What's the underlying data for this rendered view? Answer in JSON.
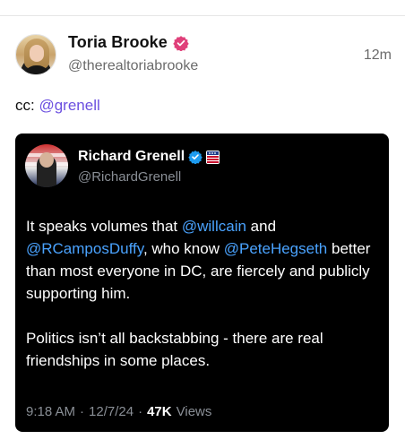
{
  "post": {
    "author_name": "Toria Brooke",
    "author_handle": "@therealtoriabrooke",
    "time_ago": "12m",
    "text_prefix": "cc: ",
    "text_mention": "@grenell"
  },
  "embed": {
    "author_name": "Richard Grenell",
    "author_handle": "@RichardGrenell",
    "paragraph1": {
      "t1": "It speaks volumes that ",
      "m1": "@willcain",
      "t2": " and ",
      "m2": "@RCamposDuffy",
      "t3": ", who know ",
      "m3": "@PeteHegseth",
      "t4": " better than most everyone in DC, are fiercely and publicly supporting him."
    },
    "paragraph2": "Politics isn’t all backstabbing - there are real friendships in some places.",
    "time": "9:18 AM",
    "date": "12/7/24",
    "separator": "·",
    "views_count": "47K",
    "views_label": "Views"
  },
  "colors": {
    "mention_purple": "#6b4fe0",
    "mention_blue": "#4aa3ff",
    "verified_pink": "#e0407a",
    "verified_blue": "#1d9bf0",
    "embed_background": "#000000"
  },
  "icons": {
    "post_verified": "verified-badge-icon",
    "embed_verified": "verified-badge-icon",
    "embed_affiliation": "affiliation-badge-icon"
  }
}
